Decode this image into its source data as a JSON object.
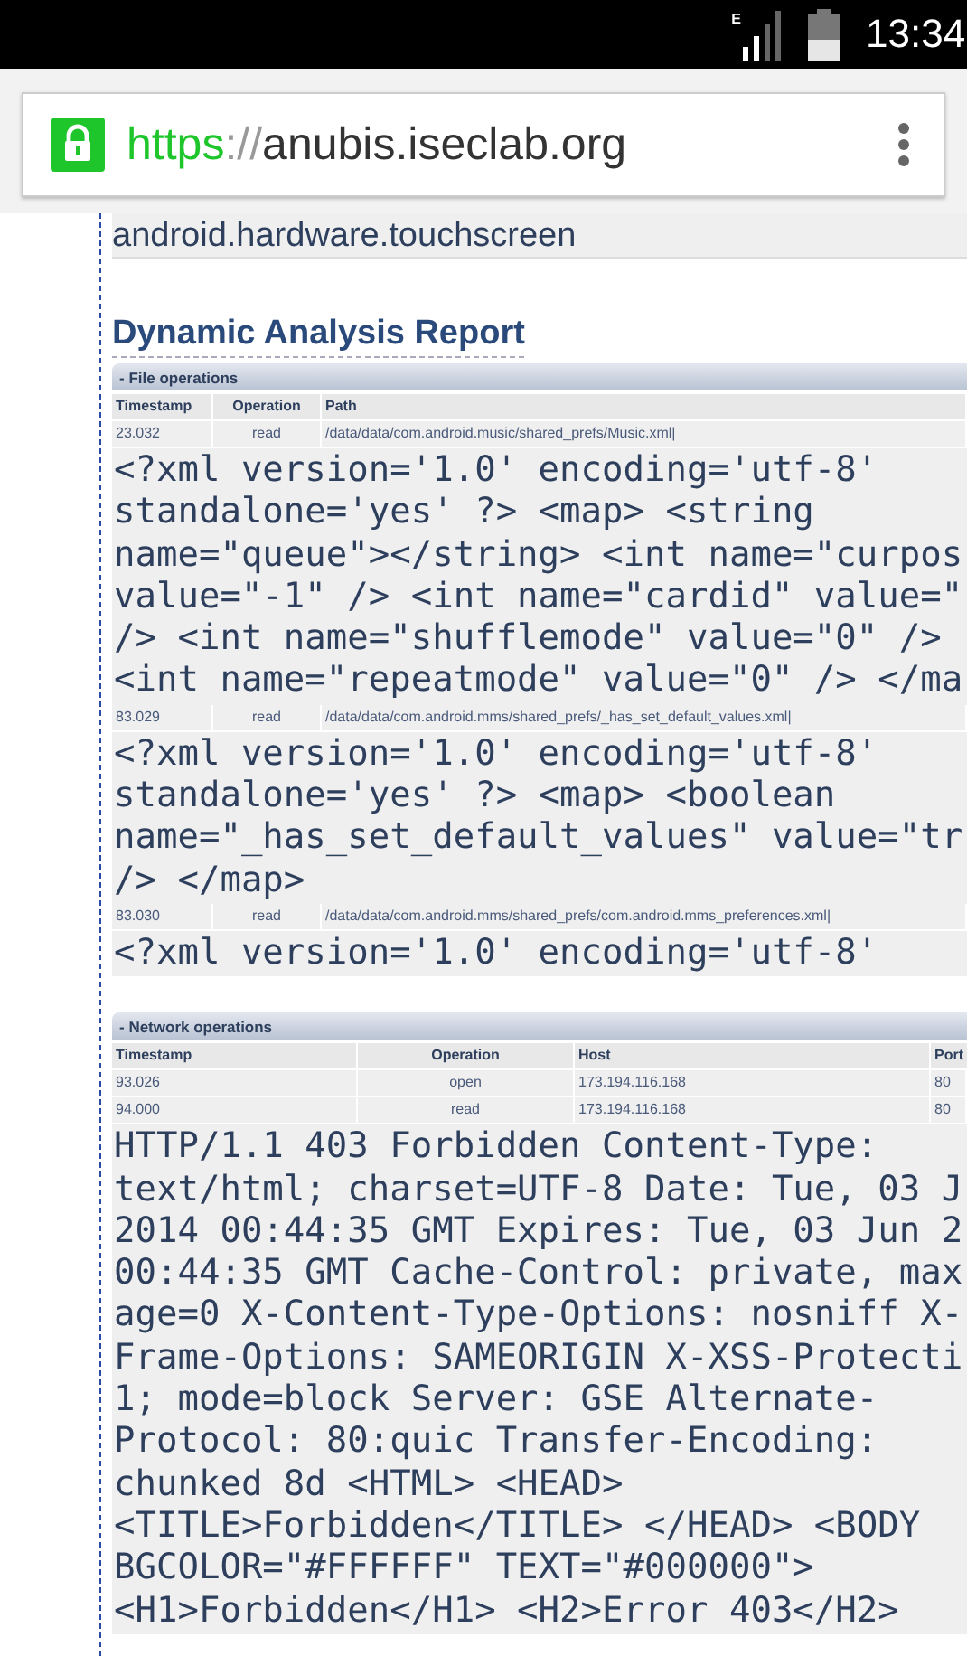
{
  "status_bar": {
    "network": "E",
    "time": "13:34"
  },
  "browser": {
    "url_scheme": "https",
    "url_separator": "://",
    "url_host": "anubis.iseclab.org"
  },
  "previous_item": "android.hardware.touchscreen",
  "heading": "Dynamic Analysis Report",
  "panels": [
    {
      "title": "- File operations",
      "columns": [
        "Timestamp",
        "Operation",
        "Path"
      ],
      "rows": [
        {
          "cells": [
            "23.032",
            "read",
            "/data/data/com.android.music/shared_prefs/Music.xml|"
          ],
          "content": [
            "<?xml version='1.0' encoding='utf-8'",
            "standalone='yes' ?> <map> <string",
            "name=\"queue\"></string> <int name=\"curpos",
            "value=\"-1\" /> <int name=\"cardid\" value=\"",
            "/> <int name=\"shufflemode\" value=\"0\" />",
            "<int name=\"repeatmode\" value=\"0\" /> </ma"
          ]
        },
        {
          "cells": [
            "83.029",
            "read",
            "/data/data/com.android.mms/shared_prefs/_has_set_default_values.xml|"
          ],
          "content": [
            "<?xml version='1.0' encoding='utf-8'",
            "standalone='yes' ?> <map> <boolean",
            "name=\"_has_set_default_values\" value=\"tr",
            "/> </map>"
          ]
        },
        {
          "cells": [
            "83.030",
            "read",
            "/data/data/com.android.mms/shared_prefs/com.android.mms_preferences.xml|"
          ],
          "content": [
            "<?xml version='1.0' encoding='utf-8'"
          ]
        }
      ]
    },
    {
      "title": "- Network operations",
      "columns": [
        "Timestamp",
        "Operation",
        "Host",
        "Port"
      ],
      "rows": [
        {
          "cells": [
            "93.026",
            "open",
            "173.194.116.168",
            "80"
          ]
        },
        {
          "cells": [
            "94.000",
            "read",
            "173.194.116.168",
            "80"
          ],
          "content": [
            "HTTP/1.1 403 Forbidden Content-Type:",
            "text/html; charset=UTF-8 Date: Tue, 03 J",
            "2014 00:44:35 GMT Expires: Tue, 03 Jun 2",
            "00:44:35 GMT Cache-Control: private, max",
            "age=0 X-Content-Type-Options: nosniff X-",
            "Frame-Options: SAMEORIGIN X-XSS-Protecti",
            "1; mode=block Server: GSE Alternate-",
            "Protocol: 80:quic Transfer-Encoding:",
            "chunked 8d <HTML> <HEAD>",
            "<TITLE>Forbidden</TITLE> </HEAD> <BODY",
            "BGCOLOR=\"#FFFFFF\" TEXT=\"#000000\">",
            "<H1>Forbidden</H1> <H2>Error 403</H2>"
          ]
        }
      ]
    }
  ]
}
